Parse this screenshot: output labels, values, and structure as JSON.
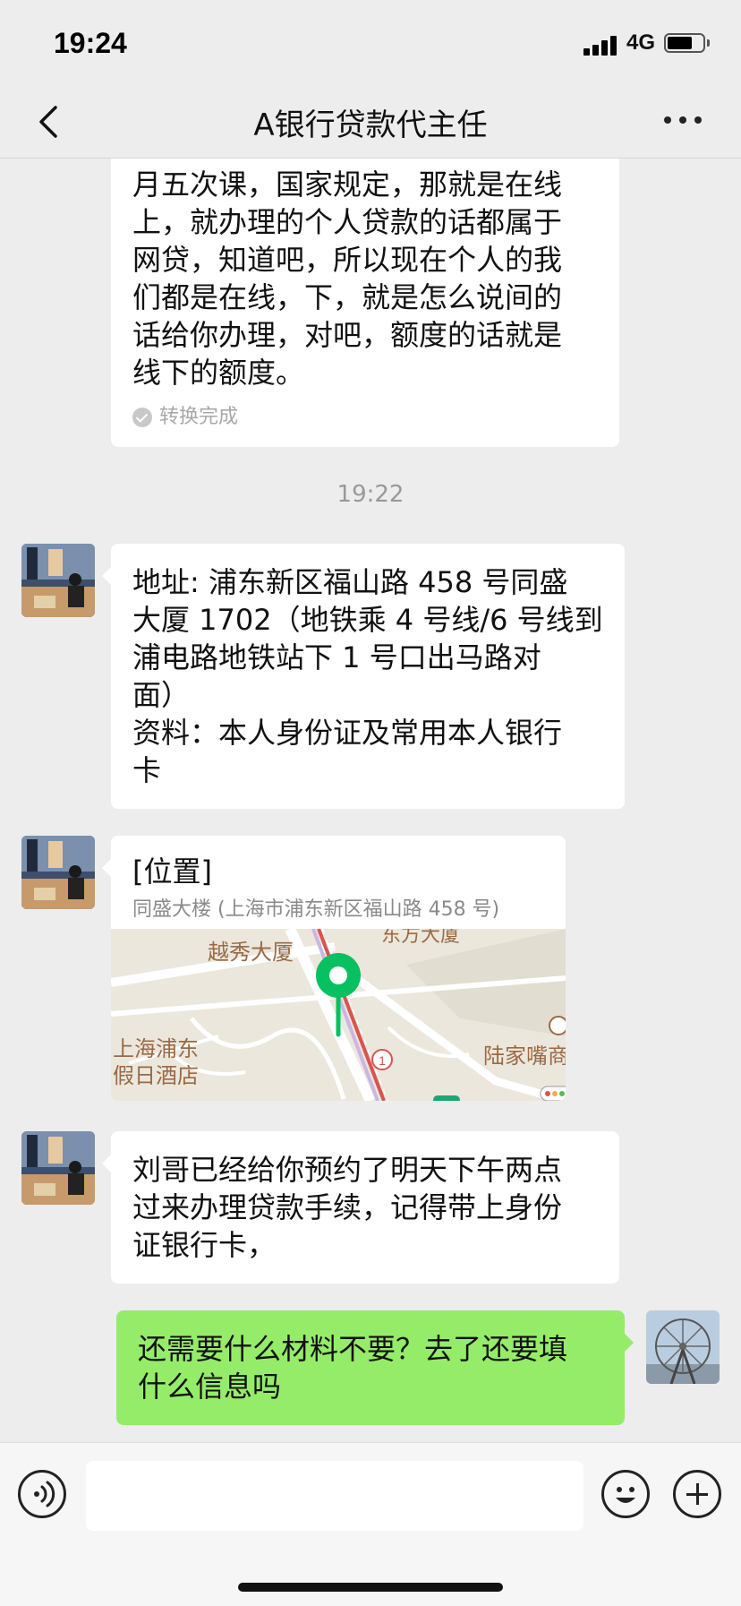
{
  "status_bar": {
    "time": "19:24",
    "network": "4G",
    "battery_level": 0.7
  },
  "nav": {
    "title": "A银行贷款代主任"
  },
  "messages": [
    {
      "side": "left",
      "lines": [
        "月五次课，国家规定，那就是在线",
        "上，就办理的个人贷款的话都属于",
        "网贷，知道吧，所以现在个人的我",
        "们都是在线，下，就是怎么说间的",
        "话给你办理，对吧，额度的话就是",
        "线下的额度。"
      ],
      "status": "转换完成"
    },
    {
      "type": "timestamp",
      "text": "19:22"
    },
    {
      "side": "left",
      "lines": [
        "地址: 浦东新区福山路 458 号同盛",
        "大厦 1702（地铁乘 4 号线/6 号线到",
        "浦电路地铁站下 1 号口出马路对",
        "面）",
        "资料：本人身份证及常用本人银行",
        "卡"
      ]
    },
    {
      "side": "left",
      "type": "location",
      "title": "[位置]",
      "address": "同盛大楼 (上海市浦东新区福山路 458 号)",
      "map_labels": [
        "越秀大厦",
        "东方大厦",
        "上海浦东",
        "假日酒店",
        "陆家嘴商",
        "1"
      ]
    },
    {
      "side": "left",
      "lines": [
        "刘哥已经给你预约了明天下午两点",
        "过来办理贷款手续，记得带上身份",
        "证银行卡，"
      ]
    },
    {
      "side": "right",
      "lines": [
        "还需要什么材料不要？去了还要填",
        "什么信息吗"
      ]
    }
  ],
  "input": {
    "value": "",
    "placeholder": ""
  },
  "colors": {
    "background": "#ededed",
    "self_bubble": "#95ec69",
    "map_pin": "#07c160",
    "metro_line": "#d9534f"
  }
}
